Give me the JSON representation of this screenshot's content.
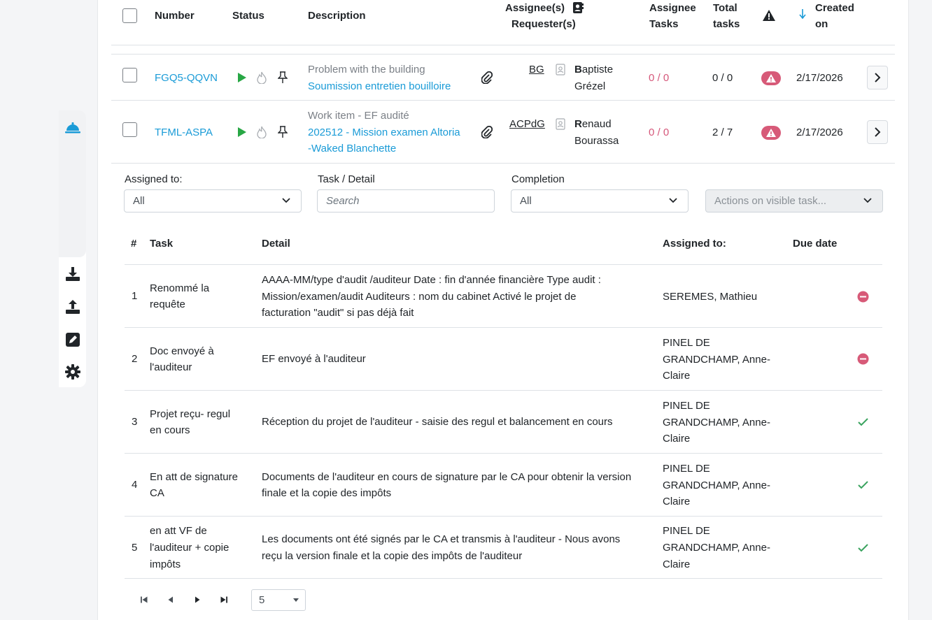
{
  "sidebar": {
    "items": [
      {
        "icon": "bell-service-icon",
        "active": true
      },
      {
        "icon": "download-icon"
      },
      {
        "icon": "upload-icon"
      },
      {
        "icon": "edit-icon"
      },
      {
        "icon": "gear-icon"
      }
    ],
    "active_color": "#1a9bd7"
  },
  "requests_table": {
    "headers": {
      "number": "Number",
      "status": "Status",
      "description": "Description",
      "assignees_line1": "Assignee(s)",
      "assignees_line2": "Requester(s)",
      "assignee_tasks_line1": "Assignee",
      "assignee_tasks_line2": "Tasks",
      "total_tasks_line1": "Total",
      "total_tasks_line2": "tasks",
      "created_line1": "Created",
      "created_line2": "on"
    },
    "rows": [
      {
        "number": "FGQ5-QQVN",
        "type": "Problem with the building",
        "title": "Soumission entretien bouilloire",
        "title_line2": "",
        "assignee": "BG",
        "requester_initial": "B",
        "requester_first_rest": "aptiste",
        "requester_last": "Grézel",
        "assignee_tasks": "0 / 0",
        "total_tasks": "0 / 0",
        "created": "2/17/2026"
      },
      {
        "number": "TFML-ASPA",
        "type": "Work item - EF audité",
        "title": "202512 - Mission examen Altoria",
        "title_line2": "-Waked Blanchette",
        "assignee": "ACPdG",
        "requester_initial": "R",
        "requester_first_rest": "enaud",
        "requester_last": "Bourassa",
        "assignee_tasks": "0 / 0",
        "total_tasks": "2 / 7",
        "created": "2/17/2026"
      }
    ]
  },
  "filters": {
    "assigned_to_label": "Assigned to:",
    "assigned_to_value": "All",
    "task_detail_label": "Task / Detail",
    "search_placeholder": "Search",
    "completion_label": "Completion",
    "completion_value": "All",
    "actions_placeholder": "Actions on visible task..."
  },
  "tasks_table": {
    "headers": {
      "num": "#",
      "task": "Task",
      "detail": "Detail",
      "assigned_to": "Assigned to:",
      "due_date": "Due date"
    },
    "rows": [
      {
        "num": "1",
        "task_l1": "Renommé la",
        "task_l2": "requête",
        "task_l3": "",
        "detail_l1": "AAAA-MM/type d'audit /auditeur Date : fin d'année financière Type audit :",
        "detail_l2": "Mission/examen/audit Auditeurs : nom du cabinet Activé le projet de",
        "detail_l3": "facturation \"audit\" si pas déjà fait",
        "assigned_l1": "SEREMES, Mathieu",
        "assigned_l2": "",
        "assigned_l3": "",
        "status": "minus-circle-icon"
      },
      {
        "num": "2",
        "task_l1": "Doc envoyé à",
        "task_l2": "l'auditeur",
        "task_l3": "",
        "detail_l1": "EF envoyé à l'auditeur",
        "detail_l2": "",
        "detail_l3": "",
        "assigned_l1": "PINEL DE",
        "assigned_l2": "GRANDCHAMP, Anne-",
        "assigned_l3": "Claire",
        "status": "minus-circle-icon"
      },
      {
        "num": "3",
        "task_l1": "Projet reçu- regul",
        "task_l2": "en cours",
        "task_l3": "",
        "detail_l1": "Réception du projet de l'auditeur - saisie des regul et balancement en cours",
        "detail_l2": "",
        "detail_l3": "",
        "assigned_l1": "PINEL DE",
        "assigned_l2": "GRANDCHAMP, Anne-",
        "assigned_l3": "Claire",
        "status": "check-icon"
      },
      {
        "num": "4",
        "task_l1": "En att de signature",
        "task_l2": "CA",
        "task_l3": "",
        "detail_l1": "Documents de l'auditeur en cours de signature par le CA pour obtenir la version",
        "detail_l2": "finale et la copie des impôts",
        "detail_l3": "",
        "assigned_l1": "PINEL DE",
        "assigned_l2": "GRANDCHAMP, Anne-",
        "assigned_l3": "Claire",
        "status": "check-icon"
      },
      {
        "num": "5",
        "task_l1": "en att VF de",
        "task_l2": "l'auditeur + copie",
        "task_l3": "impôts",
        "detail_l1": "Les documents ont été signés par le CA et transmis à l'auditeur - Nous avons",
        "detail_l2": "reçu la version finale et la copie des impôts de l'auditeur",
        "detail_l3": "",
        "assigned_l1": "PINEL DE",
        "assigned_l2": "GRANDCHAMP, Anne-",
        "assigned_l3": "Claire",
        "status": "check-icon"
      }
    ]
  },
  "pagination": {
    "page_size": "5"
  },
  "colors": {
    "link": "#1a9bd7",
    "play": "#28a745",
    "warn": "#d75a78",
    "pink_text": "#d5577a",
    "minus": "#d75a78",
    "check": "#3aa35f"
  }
}
